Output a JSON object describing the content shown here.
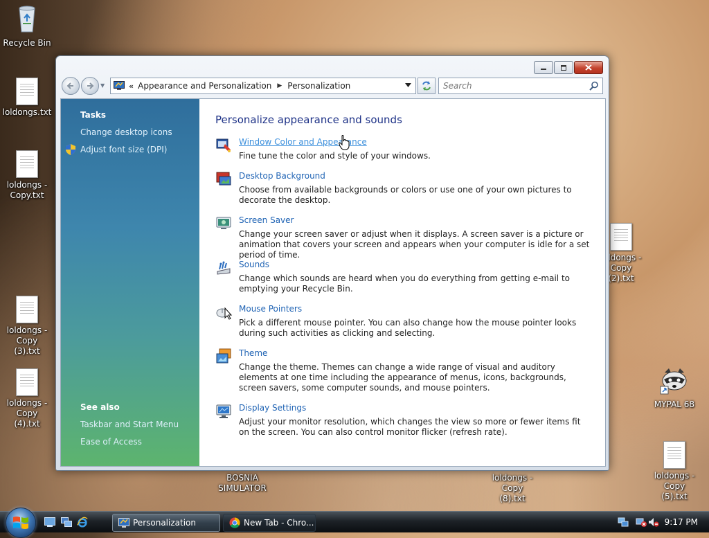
{
  "desktop": {
    "icons": [
      {
        "label": "Recycle Bin",
        "icon": "recycle-bin-icon"
      },
      {
        "label": "loldongs.txt",
        "icon": "text-file-icon"
      },
      {
        "label": "loldongs - Copy.txt",
        "icon": "text-file-icon"
      },
      {
        "label": "loldongs - Copy (3).txt",
        "icon": "text-file-icon"
      },
      {
        "label": "loldongs - Copy (4).txt",
        "icon": "text-file-icon"
      },
      {
        "label": "loldongs - Copy (2).txt",
        "icon": "text-file-icon"
      },
      {
        "label": "MYPAL 68",
        "icon": "raccoon-shortcut-icon"
      },
      {
        "label": "BOSNIA SIMULATOR",
        "icon": null
      },
      {
        "label": "loldongs - Copy (8).txt",
        "icon": null
      },
      {
        "label": "loldongs - Copy (5).txt",
        "icon": "text-file-icon"
      }
    ]
  },
  "window": {
    "title": "Personalization",
    "address": {
      "chevron": "«",
      "crumbs": [
        "Appearance and Personalization",
        "Personalization"
      ]
    },
    "search": {
      "placeholder": "Search"
    },
    "left_pane": {
      "tasks_heading": "Tasks",
      "tasks": [
        "Change desktop icons",
        "Adjust font size (DPI)"
      ],
      "see_also_heading": "See also",
      "see_also": [
        "Taskbar and Start Menu",
        "Ease of Access"
      ]
    },
    "main": {
      "title": "Personalize appearance and sounds",
      "items": [
        {
          "label": "Window Color and Appearance",
          "description": "Fine tune the color and style of your windows."
        },
        {
          "label": "Desktop Background",
          "description": "Choose from available backgrounds or colors or use one of your own pictures to decorate the desktop."
        },
        {
          "label": "Screen Saver",
          "description": "Change your screen saver or adjust when it displays. A screen saver is a picture or animation that covers your screen and appears when your computer is idle for a set period of time."
        },
        {
          "label": "Sounds",
          "description": "Change which sounds are heard when you do everything from getting e-mail to emptying your Recycle Bin."
        },
        {
          "label": "Mouse Pointers",
          "description": "Pick a different mouse pointer. You can also change how the mouse pointer looks during such activities as clicking and selecting."
        },
        {
          "label": "Theme",
          "description": "Change the theme. Themes can change a wide range of visual and auditory elements at one time including the appearance of menus, icons, backgrounds, screen savers, some computer sounds, and mouse pointers."
        },
        {
          "label": "Display Settings",
          "description": "Adjust your monitor resolution, which changes the view so more or fewer items fit on the screen. You can also control monitor flicker (refresh rate)."
        }
      ]
    }
  },
  "taskbar": {
    "buttons": [
      {
        "label": "Personalization",
        "active": true
      },
      {
        "label": "New Tab - Chro...",
        "active": false
      }
    ],
    "clock": "9:17 PM"
  },
  "colors": {
    "link": "#1f63b4",
    "link_hover": "#3b8fdc",
    "title": "#1e3287",
    "pane_top": "#2f6e9c",
    "pane_bottom": "#5db46e"
  }
}
